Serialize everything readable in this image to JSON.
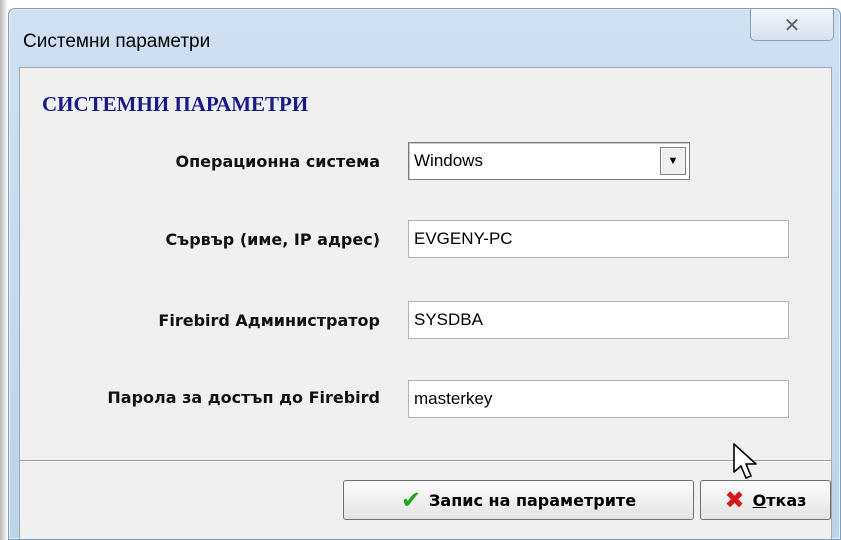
{
  "window": {
    "title": "Системни параметри",
    "close_glyph": "✕"
  },
  "section_title": "СИСТЕМНИ ПАРАМЕТРИ",
  "fields": {
    "os_label": "Операционна система",
    "os_value": "Windows",
    "server_label": "Сървър (име, IP адрес)",
    "server_value": "EVGENY-PC",
    "admin_label": "Firebird Администратор",
    "admin_value": "SYSDBA",
    "password_label": "Парола за достъп до Firebird",
    "password_value": "masterkey"
  },
  "buttons": {
    "save_label": "Запис на параметрите",
    "cancel_label_first": "О",
    "cancel_label_rest": "тказ"
  },
  "icons": {
    "check": "✔",
    "cancel": "✖",
    "dropdown": "▼"
  }
}
